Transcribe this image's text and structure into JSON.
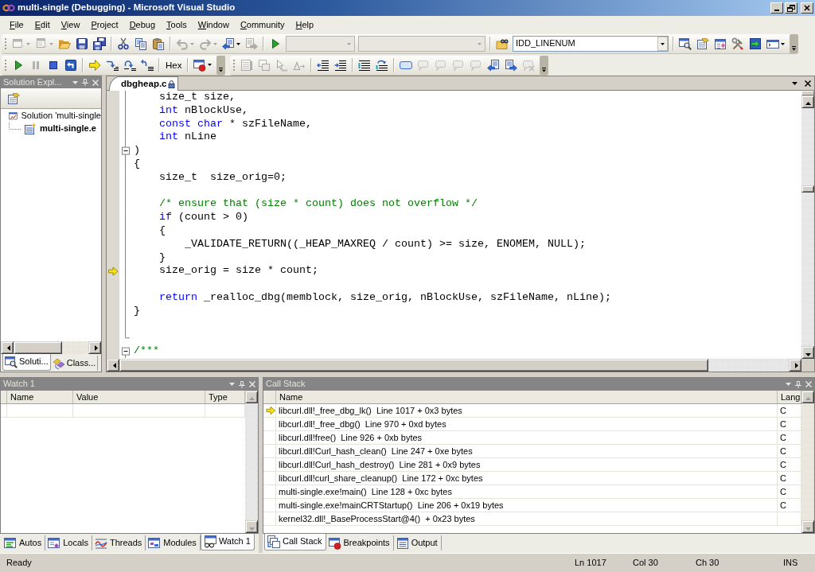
{
  "window": {
    "title": "multi-single (Debugging) - Microsoft Visual Studio"
  },
  "menu": [
    "File",
    "Edit",
    "View",
    "Project",
    "Debug",
    "Tools",
    "Window",
    "Community",
    "Help"
  ],
  "toolbar_rows": [
    {
      "toolbars": [
        {
          "items": [
            {
              "kind": "grip"
            },
            {
              "kind": "button",
              "disabled": true,
              "dropdown": true
            },
            {
              "kind": "button",
              "disabled": true,
              "dropdown": true
            },
            {
              "kind": "button",
              "disabled": false,
              "dropdown": false
            },
            {
              "kind": "button",
              "disabled": false,
              "dropdown": false
            },
            {
              "kind": "button",
              "disabled": false,
              "dropdown": false
            },
            {
              "kind": "separator"
            },
            {
              "kind": "button",
              "disabled": false,
              "dropdown": false
            },
            {
              "kind": "button",
              "disabled": false,
              "dropdown": false
            },
            {
              "kind": "button",
              "disabled": false,
              "dropdown": false
            },
            {
              "kind": "separator"
            },
            {
              "kind": "button",
              "disabled": true,
              "dropdown": true
            },
            {
              "kind": "button",
              "disabled": true,
              "dropdown": true
            },
            {
              "kind": "button",
              "disabled": false,
              "dropdown": true
            },
            {
              "kind": "button",
              "disabled": true,
              "dropdown": false
            },
            {
              "kind": "separator"
            },
            {
              "kind": "button",
              "disabled": false,
              "dropdown": false
            },
            {
              "kind": "combo",
              "disabled": true
            },
            {
              "kind": "combo",
              "disabled": true
            },
            {
              "kind": "separator"
            },
            {
              "kind": "button",
              "disabled": false,
              "dropdown": false
            },
            {
              "kind": "combo",
              "disabled": false,
              "value": "IDD_LINENUM"
            },
            {
              "kind": "separator"
            },
            {
              "kind": "button",
              "disabled": false,
              "dropdown": false
            },
            {
              "kind": "button",
              "disabled": false,
              "dropdown": false
            },
            {
              "kind": "button",
              "disabled": false,
              "dropdown": false
            },
            {
              "kind": "button",
              "disabled": false,
              "dropdown": false
            },
            {
              "kind": "button",
              "disabled": false,
              "dropdown": false
            },
            {
              "kind": "button",
              "disabled": false,
              "dropdown": true
            },
            {
              "kind": "overflow"
            }
          ]
        }
      ]
    },
    {
      "toolbars": [
        {
          "items": [
            {
              "kind": "grip"
            },
            {
              "kind": "button",
              "disabled": false,
              "dropdown": false
            },
            {
              "kind": "button",
              "disabled": true,
              "dropdown": false
            },
            {
              "kind": "button",
              "disabled": false,
              "dropdown": false
            },
            {
              "kind": "button",
              "disabled": false,
              "dropdown": false
            },
            {
              "kind": "separator"
            },
            {
              "kind": "button",
              "disabled": false,
              "dropdown": false
            },
            {
              "kind": "button",
              "disabled": false,
              "dropdown": false
            },
            {
              "kind": "button",
              "disabled": false,
              "dropdown": false
            },
            {
              "kind": "button",
              "disabled": false,
              "dropdown": false
            },
            {
              "kind": "separator"
            },
            {
              "kind": "text_button",
              "label": "Hex"
            },
            {
              "kind": "separator"
            },
            {
              "kind": "button",
              "disabled": false,
              "dropdown": true
            },
            {
              "kind": "overflow"
            }
          ]
        },
        {
          "items": [
            {
              "kind": "grip"
            },
            {
              "kind": "button",
              "disabled": true,
              "dropdown": false
            },
            {
              "kind": "button",
              "disabled": true,
              "dropdown": false
            },
            {
              "kind": "button",
              "disabled": true,
              "dropdown": false
            },
            {
              "kind": "button",
              "disabled": true,
              "dropdown": false
            },
            {
              "kind": "separator"
            },
            {
              "kind": "button",
              "disabled": false,
              "dropdown": false
            },
            {
              "kind": "button",
              "disabled": false,
              "dropdown": false
            },
            {
              "kind": "separator"
            },
            {
              "kind": "button",
              "disabled": false,
              "dropdown": false
            },
            {
              "kind": "button",
              "disabled": false,
              "dropdown": false
            },
            {
              "kind": "separator"
            },
            {
              "kind": "button",
              "disabled": false,
              "dropdown": false
            },
            {
              "kind": "button",
              "disabled": true,
              "dropdown": false
            },
            {
              "kind": "button",
              "disabled": true,
              "dropdown": false
            },
            {
              "kind": "button",
              "disabled": true,
              "dropdown": false
            },
            {
              "kind": "button",
              "disabled": true,
              "dropdown": false
            },
            {
              "kind": "button",
              "disabled": false,
              "dropdown": false
            },
            {
              "kind": "button",
              "disabled": false,
              "dropdown": false
            },
            {
              "kind": "button",
              "disabled": true,
              "dropdown": false
            },
            {
              "kind": "overflow"
            }
          ]
        }
      ]
    }
  ],
  "solution_explorer": {
    "title": "Solution Expl...",
    "tree": [
      {
        "kind": "solution",
        "label": "Solution 'multi-single",
        "startup": false,
        "children": [
          {
            "kind": "project",
            "label": "multi-single.e",
            "startup": true
          }
        ]
      }
    ],
    "tabs": [
      {
        "label": "Soluti...",
        "selected": true
      },
      {
        "label": "Class...",
        "selected": false
      }
    ]
  },
  "editor": {
    "tabs": [
      {
        "label": "dbgheap.c",
        "selected": true,
        "read_only": true
      }
    ],
    "lines": [
      {
        "kind": "code",
        "segments": [
          {
            "kind": "plain",
            "text": "    size_t size,"
          }
        ],
        "current": false,
        "foldable": false,
        "region_end": false
      },
      {
        "kind": "code",
        "segments": [
          {
            "kind": "keyword",
            "text": "    int"
          },
          {
            "kind": "plain",
            "text": " nBlockUse,"
          }
        ],
        "current": false,
        "foldable": false,
        "region_end": false
      },
      {
        "kind": "code",
        "segments": [
          {
            "kind": "keyword",
            "text": "    const"
          },
          {
            "kind": "keyword",
            "text": " char"
          },
          {
            "kind": "plain",
            "text": " * szFileName,"
          }
        ],
        "current": false,
        "foldable": false,
        "region_end": false
      },
      {
        "kind": "code",
        "segments": [
          {
            "kind": "keyword",
            "text": "    int"
          },
          {
            "kind": "plain",
            "text": " nLine"
          }
        ],
        "current": false,
        "foldable": false,
        "region_end": false
      },
      {
        "kind": "code",
        "segments": [
          {
            "kind": "plain",
            "text": ")"
          }
        ],
        "current": false,
        "foldable": true,
        "region_end": false
      },
      {
        "kind": "code",
        "segments": [
          {
            "kind": "plain",
            "text": "{"
          }
        ],
        "current": false,
        "foldable": false,
        "region_end": false
      },
      {
        "kind": "code",
        "segments": [
          {
            "kind": "plain",
            "text": "    size_t  size_orig=0;"
          }
        ],
        "current": false,
        "foldable": false,
        "region_end": false
      },
      {
        "kind": "blank",
        "current": false,
        "foldable": false,
        "region_end": false
      },
      {
        "kind": "code",
        "segments": [
          {
            "kind": "comment",
            "text": "    /* ensure that (size * count) does not overflow */"
          }
        ],
        "current": false,
        "foldable": false,
        "region_end": false
      },
      {
        "kind": "code",
        "segments": [
          {
            "kind": "keyword",
            "text": "    if"
          },
          {
            "kind": "plain",
            "text": " (count > 0)"
          }
        ],
        "current": false,
        "foldable": false,
        "region_end": false
      },
      {
        "kind": "code",
        "segments": [
          {
            "kind": "plain",
            "text": "    {"
          }
        ],
        "current": false,
        "foldable": false,
        "region_end": false
      },
      {
        "kind": "code",
        "segments": [
          {
            "kind": "plain",
            "text": "        _VALIDATE_RETURN((_HEAP_MAXREQ / count) >= size, ENOMEM, NULL);"
          }
        ],
        "current": false,
        "foldable": false,
        "region_end": false
      },
      {
        "kind": "code",
        "segments": [
          {
            "kind": "plain",
            "text": "    }"
          }
        ],
        "current": false,
        "foldable": false,
        "region_end": false
      },
      {
        "kind": "code",
        "segments": [
          {
            "kind": "plain",
            "text": "    size_orig = size * count;"
          }
        ],
        "current": true,
        "foldable": false,
        "region_end": false
      },
      {
        "kind": "blank",
        "current": false,
        "foldable": false,
        "region_end": false
      },
      {
        "kind": "code",
        "segments": [
          {
            "kind": "keyword",
            "text": "    return"
          },
          {
            "kind": "plain",
            "text": " _realloc_dbg(memblock, size_orig, nBlockUse, szFileName, nLine);"
          }
        ],
        "current": false,
        "foldable": false,
        "region_end": false
      },
      {
        "kind": "code",
        "segments": [
          {
            "kind": "plain",
            "text": "}"
          }
        ],
        "current": false,
        "foldable": false,
        "region_end": false
      },
      {
        "kind": "blank",
        "current": false,
        "foldable": false,
        "region_end": false
      },
      {
        "kind": "blank",
        "current": false,
        "foldable": false,
        "region_end": true
      },
      {
        "kind": "code",
        "segments": [
          {
            "kind": "comment",
            "text": "/***"
          }
        ],
        "current": false,
        "foldable": true,
        "region_end": false
      }
    ]
  },
  "watch": {
    "title": "Watch 1",
    "columns": [
      "Name",
      "Value",
      "Type"
    ],
    "tabs": [
      {
        "label": "Autos",
        "selected": false
      },
      {
        "label": "Locals",
        "selected": false
      },
      {
        "label": "Threads",
        "selected": false
      },
      {
        "label": "Modules",
        "selected": false
      },
      {
        "label": "Watch 1",
        "selected": true
      }
    ]
  },
  "call_stack": {
    "title": "Call Stack",
    "columns": [
      "Name",
      "Lang"
    ],
    "rows": [
      {
        "name": "libcurl.dll!_free_dbg_lk()  Line 1017 + 0x3 bytes",
        "language": "C",
        "current": true
      },
      {
        "name": "libcurl.dll!_free_dbg()  Line 970 + 0xd bytes",
        "language": "C",
        "current": false
      },
      {
        "name": "libcurl.dll!free()  Line 926 + 0xb bytes",
        "language": "C",
        "current": false
      },
      {
        "name": "libcurl.dll!Curl_hash_clean()  Line 247 + 0xe bytes",
        "language": "C",
        "current": false
      },
      {
        "name": "libcurl.dll!Curl_hash_destroy()  Line 281 + 0x9 bytes",
        "language": "C",
        "current": false
      },
      {
        "name": "libcurl.dll!curl_share_cleanup()  Line 172 + 0xc bytes",
        "language": "C",
        "current": false
      },
      {
        "name": "multi-single.exe!main()  Line 128 + 0xc bytes",
        "language": "C",
        "current": false
      },
      {
        "name": "multi-single.exe!mainCRTStartup()  Line 206 + 0x19 bytes",
        "language": "C",
        "current": false
      },
      {
        "name": "kernel32.dll!_BaseProcessStart@4()  + 0x23 bytes",
        "current": false
      }
    ],
    "tabs": [
      {
        "label": "Call Stack",
        "selected": true
      },
      {
        "label": "Breakpoints",
        "selected": false
      },
      {
        "label": "Output",
        "selected": false
      }
    ]
  },
  "status_bar": {
    "message": "Ready",
    "line": "Ln 1017",
    "column": "Col 30",
    "character": "Ch 30",
    "mode": "INS"
  }
}
